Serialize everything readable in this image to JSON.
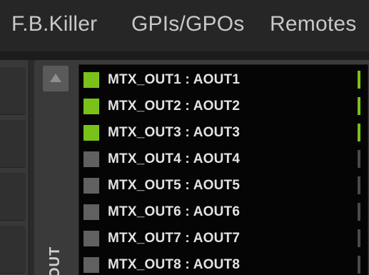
{
  "tabs": [
    "F.B.Killer",
    "GPIs/GPOs",
    "Remotes"
  ],
  "outputs_panel": {
    "vertical_label": "OUTPUTS",
    "scroll_up_icon": "triangle-up-icon",
    "items": [
      {
        "label": "MTX_OUT1 : AOUT1",
        "active": true
      },
      {
        "label": "MTX_OUT2 : AOUT2",
        "active": true
      },
      {
        "label": "MTX_OUT3 : AOUT3",
        "active": true
      },
      {
        "label": "MTX_OUT4 : AOUT4",
        "active": false
      },
      {
        "label": "MTX_OUT5 : AOUT5",
        "active": false
      },
      {
        "label": "MTX_OUT6 : AOUT6",
        "active": false
      },
      {
        "label": "MTX_OUT7 : AOUT7",
        "active": false
      },
      {
        "label": "MTX_OUT8 : AOUT8",
        "active": false
      }
    ]
  },
  "colors": {
    "active": "#7ac21a",
    "inactive": "#606060",
    "meter_inactive": "#4a4a4a"
  }
}
